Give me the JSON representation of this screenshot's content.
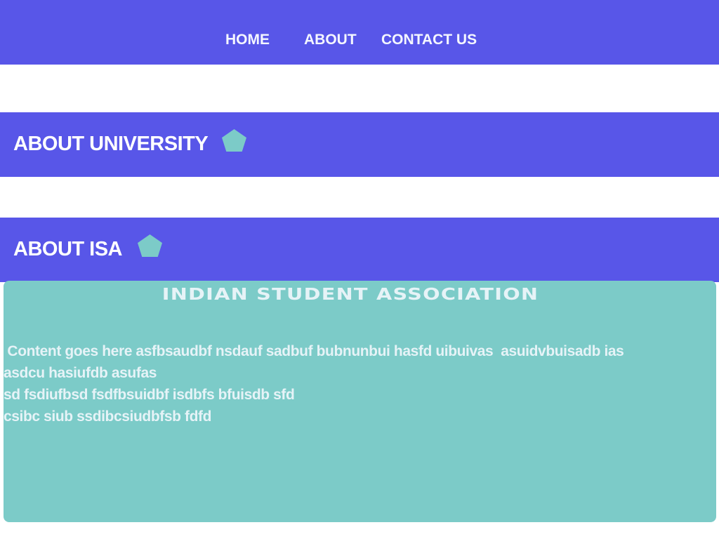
{
  "nav": {
    "links": [
      {
        "label": "HOME"
      },
      {
        "label": "ABOUT"
      },
      {
        "label": "CONTACT US"
      }
    ]
  },
  "sections": [
    {
      "title": "ABOUT UNIVERSITY",
      "icon": "pentagon-icon"
    },
    {
      "title": "ABOUT ISA",
      "icon": "pentagon-icon"
    }
  ],
  "card": {
    "heading": "INDIAN STUDENT ASSOCIATION",
    "lines": [
      " Content goes here asfbsaudbf nsdauf sadbuf bubnunbui hasfd uibuivas  asuidvbuisadb ias",
      "asdcu hasiufdb asufas",
      "sd fsdiufbsd fsdfbsuidbf isdbfs bfuisdb sfd",
      "csibc siub ssdibcsiudbfsb fdfd"
    ]
  },
  "colors": {
    "primary": "#5856e8",
    "accent": "#7ccbc8",
    "text_light": "#e6f3f7"
  }
}
